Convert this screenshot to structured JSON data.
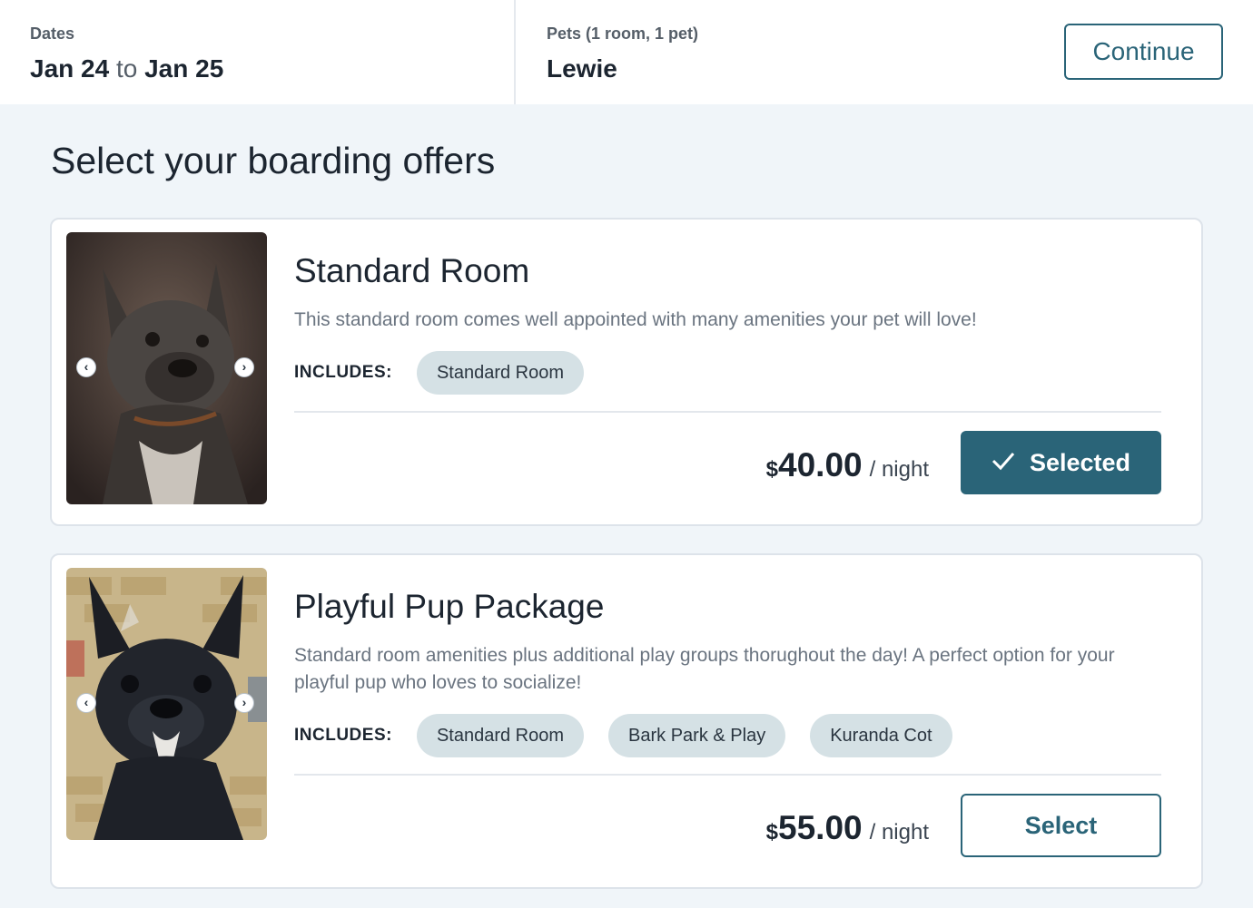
{
  "header": {
    "dates": {
      "label": "Dates",
      "start": "Jan 24",
      "to": "to",
      "end": "Jan 25"
    },
    "pets": {
      "label": "Pets (1 room, 1 pet)",
      "value": "Lewie"
    },
    "continue_label": "Continue"
  },
  "page": {
    "title": "Select your boarding offers"
  },
  "offers": [
    {
      "title": "Standard Room",
      "description": "This standard room comes well appointed with many amenities your pet will love!",
      "includes_label": "INCLUDES:",
      "includes": [
        "Standard Room"
      ],
      "price_currency": "$",
      "price_amount": "40.00",
      "price_unit": "/ night",
      "button_label": "Selected",
      "selected": true
    },
    {
      "title": "Playful Pup Package",
      "description": "Standard room amenities plus additional play groups thorughout the day! A perfect option for your playful pup who loves to socialize!",
      "includes_label": "INCLUDES:",
      "includes": [
        "Standard Room",
        "Bark Park & Play",
        "Kuranda Cot"
      ],
      "price_currency": "$",
      "price_amount": "55.00",
      "price_unit": "/ night",
      "button_label": "Select",
      "selected": false
    }
  ],
  "icons": {
    "prev": "chevron-left-icon",
    "next": "chevron-right-icon",
    "check": "checkmark-icon"
  },
  "colors": {
    "accent": "#2a6478",
    "chip": "#d5e1e5",
    "background": "#f0f5f9"
  }
}
